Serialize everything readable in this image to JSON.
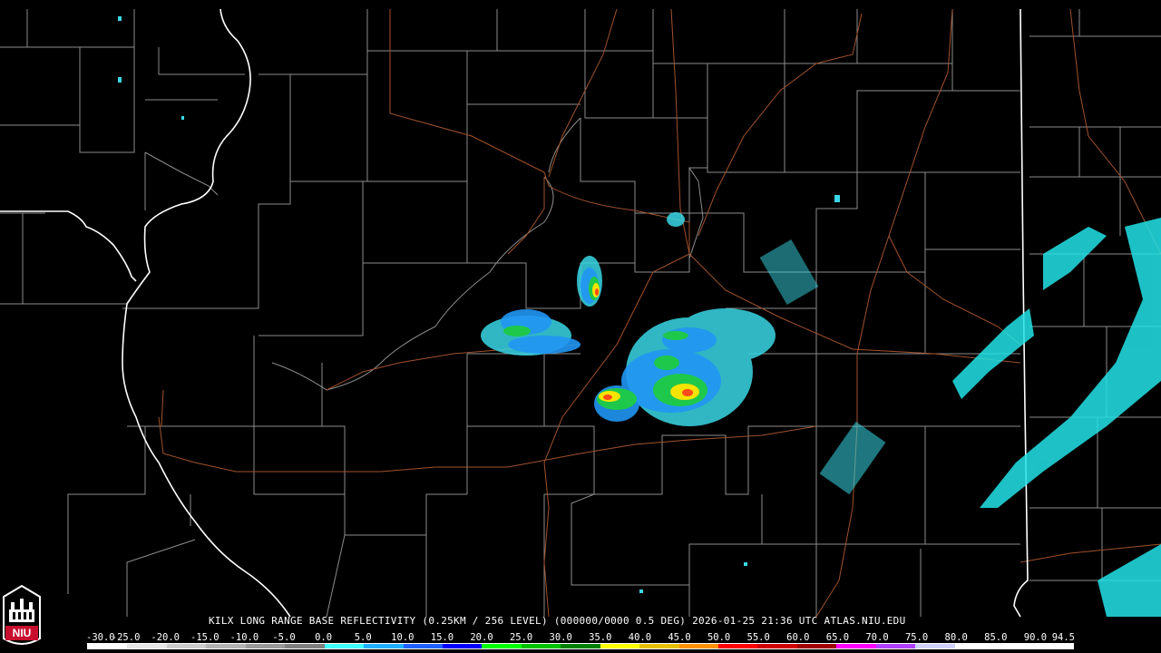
{
  "caption": {
    "station": "KILX",
    "product": "LONG RANGE BASE REFLECTIVITY",
    "resolution": "(0.25KM / 256 LEVEL)",
    "elevation": "(000000/0000 0.5 DEG)",
    "timestamp": "2026-01-25 21:36 UTC",
    "source": "ATLAS.NIU.EDU"
  },
  "logo": {
    "text": "NIU"
  },
  "colors": {
    "background": "#000000",
    "county_lines": "#8c8c8c",
    "state_lines": "#ffffff",
    "highways": "#a0522d"
  },
  "scale": {
    "labels": [
      "-30.0",
      "-25.0",
      "-20.0",
      "-15.0",
      "-10.0",
      "-5.0",
      "0.0",
      "5.0",
      "10.0",
      "15.0",
      "20.0",
      "25.0",
      "30.0",
      "35.0",
      "40.0",
      "45.0",
      "50.0",
      "55.0",
      "60.0",
      "65.0",
      "70.0",
      "75.0",
      "80.0",
      "85.0",
      "90.0",
      "94.5"
    ],
    "colors": [
      "#ffffff",
      "#e6e6e6",
      "#cccccc",
      "#b3b3b3",
      "#999999",
      "#808080",
      "#40ffff",
      "#20b0ff",
      "#2060ff",
      "#0000ff",
      "#00ff00",
      "#00c000",
      "#008000",
      "#ffff00",
      "#e6c000",
      "#ff9000",
      "#ff0000",
      "#d00000",
      "#a00000",
      "#ff00ff",
      "#b040ff",
      "#d0d0ff",
      "#ffffff",
      "#ffffff",
      "#ffffff"
    ]
  }
}
